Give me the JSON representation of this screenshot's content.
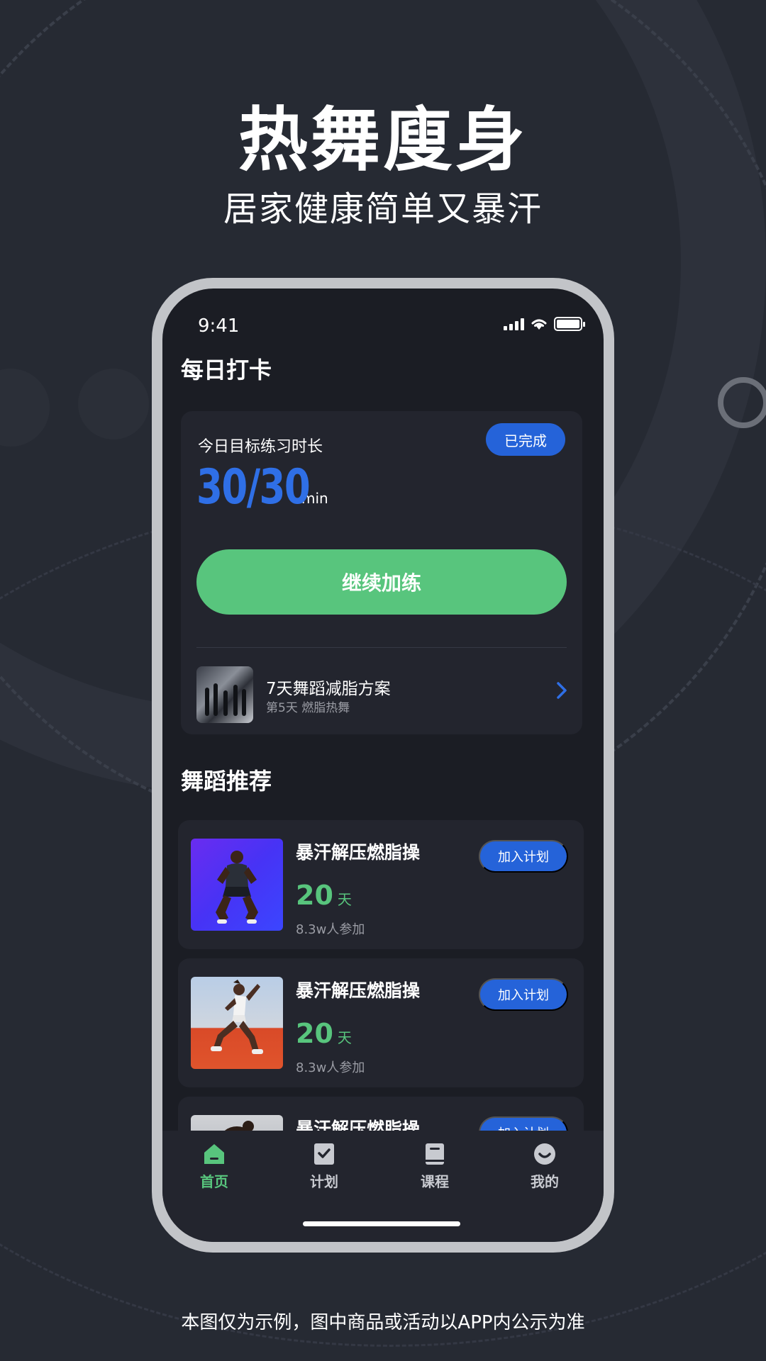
{
  "hero": {
    "title": "热舞廋身",
    "subtitle": "居家健康简单又暴汗"
  },
  "status_bar": {
    "time": "9:41"
  },
  "daily_checkin": {
    "section_title": "每日打卡",
    "goal_label": "今日目标练习时长",
    "status_badge": "已完成",
    "progress_value": "30/30",
    "progress_unit": "min",
    "continue_label": "继续加练",
    "plan": {
      "title": "7天舞蹈减脂方案",
      "subtitle": "第5天 燃脂热舞"
    }
  },
  "recommend": {
    "section_title": "舞蹈推荐",
    "items": [
      {
        "name": "暴汗解压燃脂操",
        "days": "20",
        "days_unit": "天",
        "participants": "8.3w人参加",
        "button": "加入计划",
        "thumb": "purple"
      },
      {
        "name": "暴汗解压燃脂操",
        "days": "20",
        "days_unit": "天",
        "participants": "8.3w人参加",
        "button": "加入计划",
        "thumb": "orange"
      },
      {
        "name": "暴汗解压燃脂操",
        "button": "加入计划",
        "thumb": "gray"
      }
    ]
  },
  "tabbar": {
    "items": [
      {
        "label": "首页",
        "icon": "home-icon",
        "active": true
      },
      {
        "label": "计划",
        "icon": "checklist-icon",
        "active": false
      },
      {
        "label": "课程",
        "icon": "book-icon",
        "active": false
      },
      {
        "label": "我的",
        "icon": "smiley-icon",
        "active": false
      }
    ]
  },
  "footer": {
    "note": "本图仅为示例，图中商品或活动以APP内公示为准"
  },
  "colors": {
    "background": "#262a33",
    "screen": "#1b1d24",
    "card": "#23252e",
    "accent_blue": "#2563d9",
    "accent_green": "#58c57d"
  }
}
